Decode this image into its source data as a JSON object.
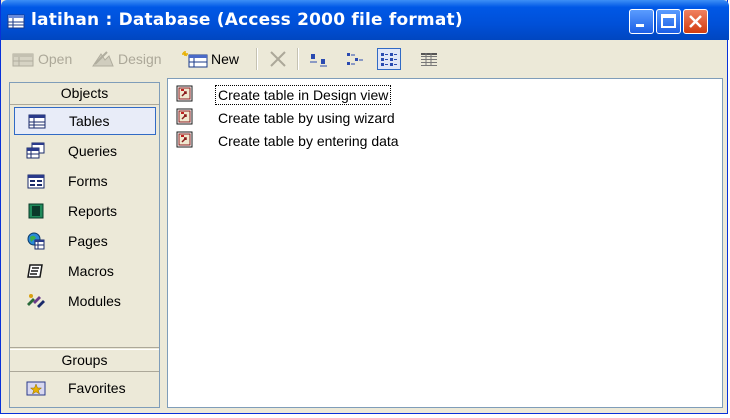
{
  "window": {
    "title": "latihan : Database (Access 2000 file format)",
    "colors": {
      "titlebar": "#0054e3",
      "close": "#d8421c",
      "face": "#ece9d8"
    }
  },
  "toolbar": {
    "open_label": "Open",
    "design_label": "Design",
    "new_label": "New"
  },
  "objects_bar": {
    "header": "Objects",
    "items": [
      {
        "label": "Tables",
        "icon": "table-icon",
        "selected": true
      },
      {
        "label": "Queries",
        "icon": "query-icon"
      },
      {
        "label": "Forms",
        "icon": "form-icon"
      },
      {
        "label": "Reports",
        "icon": "report-icon"
      },
      {
        "label": "Pages",
        "icon": "page-icon"
      },
      {
        "label": "Macros",
        "icon": "macro-icon"
      },
      {
        "label": "Modules",
        "icon": "module-icon"
      }
    ],
    "groups_header": "Groups",
    "groups": [
      {
        "label": "Favorites",
        "icon": "favorites-icon"
      }
    ]
  },
  "list": {
    "items": [
      {
        "label": "Create table in Design view",
        "icon": "shortcut-icon"
      },
      {
        "label": "Create table by using wizard",
        "icon": "shortcut-icon"
      },
      {
        "label": "Create table by entering data",
        "icon": "shortcut-icon"
      }
    ]
  }
}
